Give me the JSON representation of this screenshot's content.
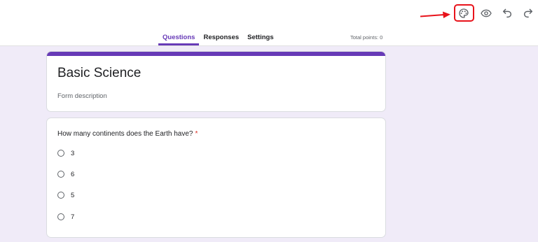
{
  "toolbar": {
    "icons": [
      "palette-icon",
      "eye-icon",
      "undo-icon",
      "redo-icon"
    ],
    "highlight_color": "#e8131b"
  },
  "tabs": [
    {
      "label": "Questions",
      "active": true
    },
    {
      "label": "Responses",
      "active": false
    },
    {
      "label": "Settings",
      "active": false
    }
  ],
  "total_points": "Total points: 0",
  "form": {
    "title": "Basic Science",
    "description_placeholder": "Form description",
    "accent_color": "#673ab7"
  },
  "question": {
    "text": "How many continents does the Earth have?",
    "required_mark": "*",
    "options": [
      "3",
      "6",
      "5",
      "7"
    ]
  }
}
